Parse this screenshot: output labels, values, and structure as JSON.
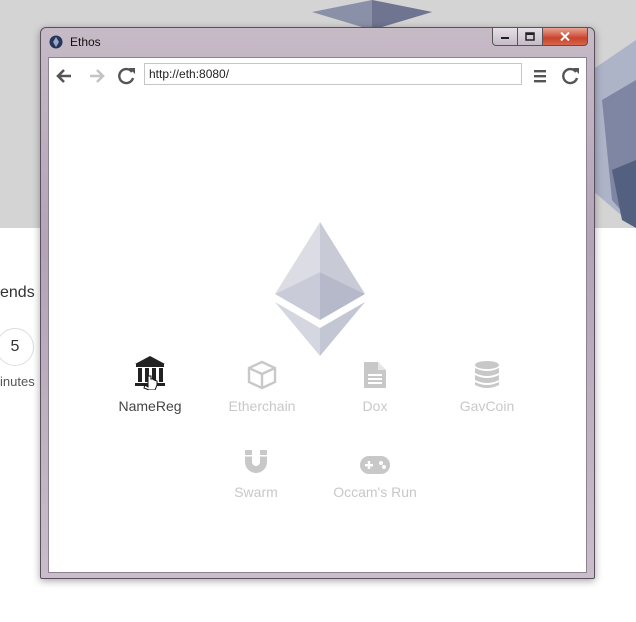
{
  "background": {
    "partial_text": "ends i",
    "counter_value": "5",
    "counter_label": "inutes"
  },
  "window": {
    "title": "Ethos",
    "controls": [
      "minimize",
      "maximize",
      "close"
    ]
  },
  "toolbar": {
    "back_icon": "arrow-left-icon",
    "forward_icon": "arrow-right-icon",
    "reload_icon": "reload-icon",
    "url": "http://eth:8080/",
    "menu_icon": "hamburger-menu-icon",
    "refresh_icon": "refresh-icon"
  },
  "apps": [
    {
      "label": "NameReg",
      "icon": "bank-icon",
      "active": true
    },
    {
      "label": "Etherchain",
      "icon": "cube-icon",
      "active": false
    },
    {
      "label": "Dox",
      "icon": "document-icon",
      "active": false
    },
    {
      "label": "GavCoin",
      "icon": "database-icon",
      "active": false
    },
    {
      "label": "Swarm",
      "icon": "magnet-icon",
      "active": false
    },
    {
      "label": "Occam's Run",
      "icon": "gamepad-icon",
      "active": false
    }
  ],
  "colors": {
    "active_text": "#444444",
    "inactive_text": "#c8c8c8",
    "window_frame": "#b3a4b6"
  }
}
